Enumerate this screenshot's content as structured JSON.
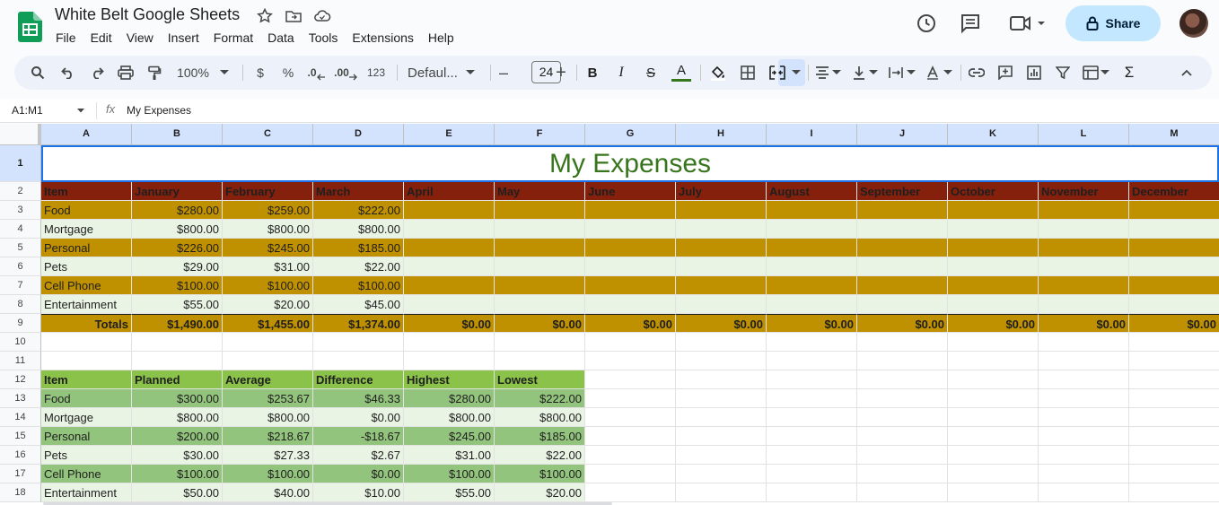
{
  "app": {
    "title": "White Belt Google Sheets",
    "menu": [
      "File",
      "Edit",
      "View",
      "Insert",
      "Format",
      "Data",
      "Tools",
      "Extensions",
      "Help"
    ],
    "share_label": "Share",
    "icons": [
      "sheets-logo",
      "star-icon",
      "move-folder-icon",
      "cloud-saved-icon",
      "history-icon",
      "comments-icon",
      "meet-icon",
      "lock-icon",
      "avatar"
    ]
  },
  "toolbar": {
    "zoom": "100%",
    "currency": "$",
    "percent": "%",
    "dec_decrease": ".0",
    "dec_increase": ".00",
    "number_format": "123",
    "font": "Defaul...",
    "font_size": "24",
    "minus": "–",
    "plus": "+",
    "bold": "B",
    "italic": "I",
    "strike": "S",
    "text_color": "A",
    "sigma": "Σ"
  },
  "formula_bar": {
    "name_box": "A1:M1",
    "fx": "fx",
    "value": "My Expenses"
  },
  "colors": {
    "header_dark_red": "#85200c",
    "band_gold": "#bf9000",
    "band_light_green": "#eaf4e4",
    "stats_header_green": "#8bc34a",
    "stats_band_green": "#93c47d",
    "title_green": "#38761d",
    "selection_blue": "#1a73e8"
  },
  "sheet": {
    "columns": [
      "A",
      "B",
      "C",
      "D",
      "E",
      "F",
      "G",
      "H",
      "I",
      "J",
      "K",
      "L",
      "M"
    ],
    "rows": [
      "1",
      "2",
      "3",
      "4",
      "5",
      "6",
      "7",
      "8",
      "9",
      "10",
      "11",
      "12",
      "13",
      "14",
      "15",
      "16",
      "17",
      "18"
    ],
    "title": "My Expenses",
    "expense_header": [
      "Item",
      "January",
      "February",
      "March",
      "April",
      "May",
      "June",
      "July",
      "August",
      "September",
      "October",
      "November",
      "December"
    ],
    "expenses": [
      [
        "Food",
        "$280.00",
        "$259.00",
        "$222.00"
      ],
      [
        "Mortgage",
        "$800.00",
        "$800.00",
        "$800.00"
      ],
      [
        "Personal",
        "$226.00",
        "$245.00",
        "$185.00"
      ],
      [
        "Pets",
        "$29.00",
        "$31.00",
        "$22.00"
      ],
      [
        "Cell Phone",
        "$100.00",
        "$100.00",
        "$100.00"
      ],
      [
        "Entertainment",
        "$55.00",
        "$20.00",
        "$45.00"
      ]
    ],
    "totals": [
      "Totals",
      "$1,490.00",
      "$1,455.00",
      "$1,374.00",
      "$0.00",
      "$0.00",
      "$0.00",
      "$0.00",
      "$0.00",
      "$0.00",
      "$0.00",
      "$0.00",
      "$0.00"
    ],
    "stats_header": [
      "Item",
      "Planned",
      "Average",
      "Difference",
      "Highest",
      "Lowest"
    ],
    "stats": [
      [
        "Food",
        "$300.00",
        "$253.67",
        "$46.33",
        "$280.00",
        "$222.00"
      ],
      [
        "Mortgage",
        "$800.00",
        "$800.00",
        "$0.00",
        "$800.00",
        "$800.00"
      ],
      [
        "Personal",
        "$200.00",
        "$218.67",
        "-$18.67",
        "$245.00",
        "$185.00"
      ],
      [
        "Pets",
        "$30.00",
        "$27.33",
        "$2.67",
        "$31.00",
        "$22.00"
      ],
      [
        "Cell Phone",
        "$100.00",
        "$100.00",
        "$0.00",
        "$100.00",
        "$100.00"
      ],
      [
        "Entertainment",
        "$50.00",
        "$40.00",
        "$10.00",
        "$55.00",
        "$20.00"
      ]
    ]
  }
}
